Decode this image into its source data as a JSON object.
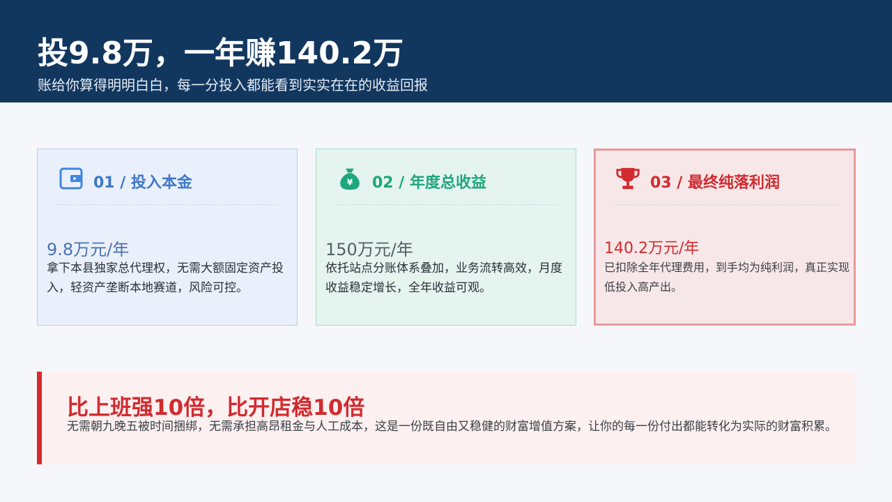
{
  "header": {
    "title": "投9.8万，一年赚140.2万",
    "subtitle": "账给你算得明明白白，每一分投入都能看到实实在在的收益回报"
  },
  "cards": [
    {
      "icon": "wallet-icon",
      "title": "01 / 投入本金",
      "value": "9.8万元/年",
      "desc": "拿下本县独家总代理权，无需大额固定资产投入，轻资产垄断本地赛道，风险可控。",
      "color": "#3e78c8"
    },
    {
      "icon": "money-bag-icon",
      "title": "02 / 年度总收益",
      "value": "150万元/年",
      "desc": "依托站点分账体系叠加，业务流转高效，月度收益稳定增长，全年收益可观。",
      "color": "#1ea77b"
    },
    {
      "icon": "trophy-icon",
      "title": "03 / 最终纯落利润",
      "value": "140.2万元/年",
      "desc": "已扣除全年代理费用，到手均为纯利润，真正实现低投入高产出。",
      "color": "#d12a2f"
    }
  ],
  "callout": {
    "title": "比上班强10倍，比开店稳10倍",
    "text": "无需朝九晚五被时间捆绑，无需承担高昂租金与人工成本，这是一份既自由又稳健的财富增值方案，让你的每一份付出都能转化为实际的财富积累。"
  }
}
